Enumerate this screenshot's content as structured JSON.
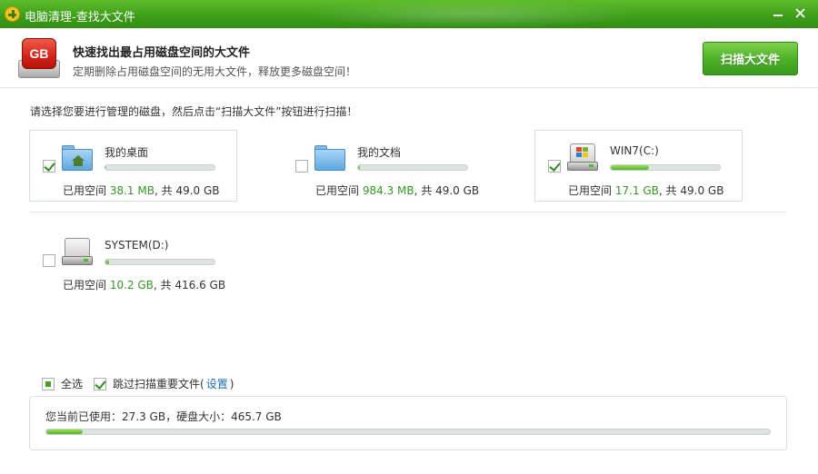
{
  "window": {
    "title": "电脑清理-查找大文件"
  },
  "header": {
    "badge_text": "GB",
    "title": "快速找出最占用磁盘空间的大文件",
    "subtitle": "定期删除占用磁盘空间的无用大文件，释放更多磁盘空间！",
    "scan_button": "扫描大文件"
  },
  "instruction": "请选择您要进行管理的磁盘，然后点击“扫描大文件”按钮进行扫描！",
  "labels": {
    "used": "已用空间",
    "total_sep": ", 共"
  },
  "disks": [
    {
      "name": "我的桌面",
      "used": "38.1 MB",
      "total": "49.0 GB",
      "checked": true,
      "usage_fraction": 0.01,
      "icon": "desktop-folder-icon"
    },
    {
      "name": "我的文档",
      "used": "984.3 MB",
      "total": "49.0 GB",
      "checked": false,
      "usage_fraction": 0.02,
      "icon": "documents-folder-icon"
    },
    {
      "name": "WIN7(C:)",
      "used": "17.1 GB",
      "total": "49.0 GB",
      "checked": true,
      "usage_fraction": 0.35,
      "icon": "system-drive-icon"
    },
    {
      "name": "SYSTEM(D:)",
      "used": "10.2 GB",
      "total": "416.6 GB",
      "checked": false,
      "usage_fraction": 0.03,
      "icon": "hard-drive-icon"
    }
  ],
  "options": {
    "select_all": "全选",
    "skip_important": "跳过扫描重要文件(",
    "settings": "设置",
    "close_paren": ")"
  },
  "usage": {
    "text": "您当前已使用：27.3 GB，硬盘大小：465.7 GB",
    "fraction": 0.05
  },
  "colors": {
    "accent": "#4fb12a",
    "used_text": "#2f9a1e",
    "link": "#1a6fc4"
  }
}
